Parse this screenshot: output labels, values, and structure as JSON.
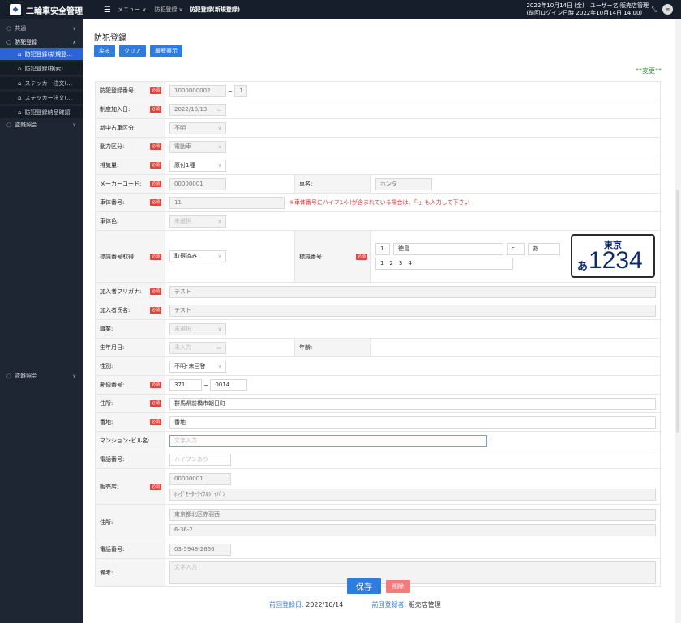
{
  "topbar": {
    "app_title": "二輪車安全管理",
    "menu_label": "メニュー ∨",
    "breadcrumb1": "防犯登録 ∨",
    "breadcrumb2": "防犯登録(新規登録)",
    "date_line": "2022年10月14日 (金)　ユーザー名:販売店管理",
    "last_login": "(前回ログイン日時 2022年10月14日 14:00)"
  },
  "sidebar": {
    "items": [
      {
        "label": "共通"
      },
      {
        "label": "防犯登録"
      },
      {
        "label": "防犯登録(新規登…"
      },
      {
        "label": "防犯登録(検索)"
      },
      {
        "label": "ステッカー注文(…"
      },
      {
        "label": "ステッカー注文(…"
      },
      {
        "label": "防犯登録納品確認"
      },
      {
        "label": "盗難照会"
      },
      {
        "label": "盗難照会"
      }
    ]
  },
  "page": {
    "title": "防犯登録",
    "btn_back": "戻る",
    "btn_clear": "クリア",
    "btn_history": "履歴表示",
    "change_note": "**変更**"
  },
  "req": "必須",
  "form": {
    "reg_no_label": "防犯登録番号:",
    "reg_no": "1000000002",
    "reg_no_dash": "−",
    "reg_no_sub": "1",
    "join_date_label": "制度加入日:",
    "join_date": "2022/10/13",
    "newold_label": "新中古車区分:",
    "newold": "不明",
    "power_label": "動力区分:",
    "power": "電動車",
    "cc_label": "排気量:",
    "cc": "原付1種",
    "maker_code_label": "メーカーコード:",
    "maker_code": "00000001",
    "maker_name_label": "車名:",
    "maker_name": "ホンダ",
    "frame_label": "車体番号:",
    "frame": "11",
    "frame_warn": "※車体番号にハイフン(-)が含まれている場合は、「-」も入力して下さい",
    "color_label": "車体色:",
    "color": "未選択",
    "plate_get_label": "標識番号取得:",
    "plate_get": "取得済み",
    "plate_label": "標識番号:",
    "plate_f1": "1",
    "plate_f2": "徳島",
    "plate_f3": "c",
    "plate_f4": "あ",
    "plate_digits": "1　2　3　4",
    "plate_city": "東京",
    "plate_kana": "あ",
    "plate_num": "1234",
    "kana_label": "加入者フリガナ:",
    "kana": "テスト",
    "name_label": "加入者氏名:",
    "name": "テスト",
    "job_label": "職業:",
    "job": "未選択",
    "birth_label": "生年月日:",
    "birth": "未入力",
    "age_label": "年齢:",
    "sex_label": "性別:",
    "sex": "不明･未回答",
    "zip_label": "郵便番号:",
    "zip1": "371",
    "zip_dash": "−",
    "zip2": "0014",
    "addr_label": "住所:",
    "addr": "群馬県前橋市朝日町",
    "banchi_label": "番地:",
    "banchi": "番地",
    "bldg_label": "マンション･ビル名:",
    "bldg_ph": "文字入力",
    "tel_label": "電話番号:",
    "tel_ph": "ハイフンあり",
    "shop_label": "販売店:",
    "shop_code": "00000001",
    "shop_name": "ﾎﾝﾀﾞﾓｰﾀｰｻｲｸﾙｼﾞｬﾊﾟﾝ",
    "shop_addr_label": "住所:",
    "shop_addr1": "東京都北区赤羽西",
    "shop_addr2": "6-36-2",
    "shop_tel_label": "電話番号:",
    "shop_tel": "03-5948-2666",
    "memo_label": "備考:",
    "memo_ph": "文字入力"
  },
  "actions": {
    "save": "保存",
    "delete": "削除"
  },
  "footer": {
    "last_date_label": "前回登録日:",
    "last_date": "2022/10/14",
    "last_user_label": "前回登録者:",
    "last_user": "販売店管理"
  }
}
